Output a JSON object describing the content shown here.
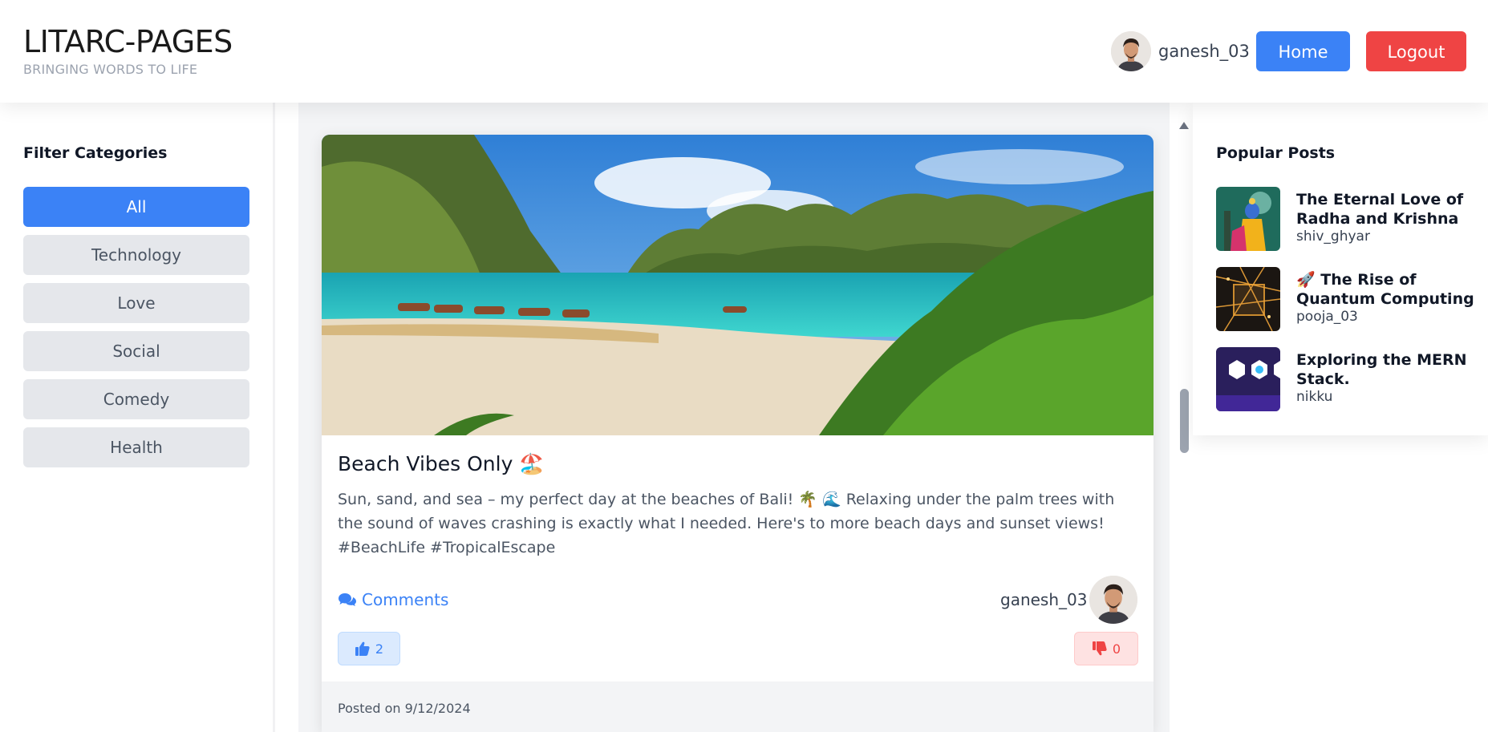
{
  "header": {
    "brand_title": "LITARC-PAGES",
    "brand_tagline": "BRINGING WORDS TO LIFE",
    "username": "ganesh_03",
    "home_label": "Home",
    "logout_label": "Logout"
  },
  "sidebar": {
    "title": "Filter Categories",
    "categories": [
      {
        "label": "All",
        "active": true
      },
      {
        "label": "Technology",
        "active": false
      },
      {
        "label": "Love",
        "active": false
      },
      {
        "label": "Social",
        "active": false
      },
      {
        "label": "Comedy",
        "active": false
      },
      {
        "label": "Health",
        "active": false
      }
    ]
  },
  "post": {
    "image_icon": "beach-lagoon-image",
    "title": "Beach Vibes Only 🏖️",
    "body": "Sun, sand, and sea – my perfect day at the beaches of Bali! 🌴 🌊 Relaxing under the palm trees with the sound of waves crashing is exactly what I needed. Here's to more beach days and sunset views! #BeachLife #TropicalEscape",
    "comments_label": "Comments",
    "author": "ganesh_03",
    "likes": "2",
    "dislikes": "0",
    "posted_on": "Posted on 9/12/2024"
  },
  "popular": {
    "title": "Popular Posts",
    "items": [
      {
        "title": "The Eternal Love of Radha and Krishna",
        "author": "shiv_ghyar"
      },
      {
        "title": "🚀 The Rise of Quantum Computing",
        "author": "pooja_03"
      },
      {
        "title": "Exploring the MERN Stack.",
        "author": "nikku"
      }
    ]
  },
  "colors": {
    "primary": "#3b82f6",
    "danger": "#ef4444",
    "muted_bg": "#e5e7eb"
  }
}
